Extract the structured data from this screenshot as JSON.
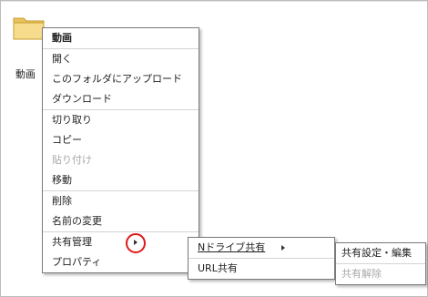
{
  "file": {
    "label": "動画",
    "icon": "folder-icon"
  },
  "context_menu": {
    "title": "動画",
    "items": {
      "open": "開く",
      "upload": "このフォルダにアップロード",
      "download": "ダウンロード",
      "cut": "切り取り",
      "copy": "コピー",
      "paste": "貼り付け",
      "move": "移動",
      "delete": "削除",
      "rename": "名前の変更",
      "share": "共有管理",
      "properties": "プロパティ"
    }
  },
  "share_submenu": {
    "n_drive_share": "Nドライブ共有",
    "url_share": "URL共有"
  },
  "ndrive_submenu": {
    "share_settings_edit": "共有設定・編集",
    "unshare": "共有解除"
  },
  "colors": {
    "highlight_ring": "#e01818",
    "folder": "#f2d27a",
    "disabled_text": "#a8a8a8"
  }
}
